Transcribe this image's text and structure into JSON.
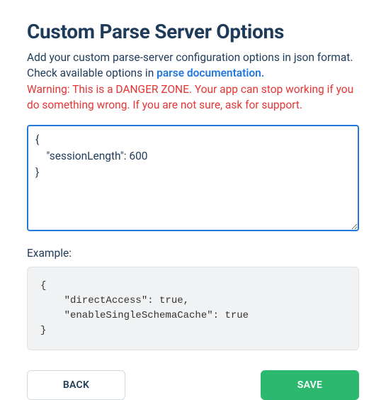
{
  "header": {
    "title": "Custom Parse Server Options",
    "description_prefix": "Add your custom parse-server configuration options in json format. Check available options in ",
    "doc_link_text": "parse documentation.",
    "warning": "Warning: This is a DANGER ZONE. Your app can stop working if you do something wrong. If you are not sure, ask for support."
  },
  "config": {
    "value": "{\n    \"sessionLength\": 600\n}"
  },
  "example": {
    "label": "Example:",
    "content": "{\n    \"directAccess\": true,\n    \"enableSingleSchemaCache\": true\n}"
  },
  "buttons": {
    "back": "BACK",
    "save": "SAVE"
  }
}
